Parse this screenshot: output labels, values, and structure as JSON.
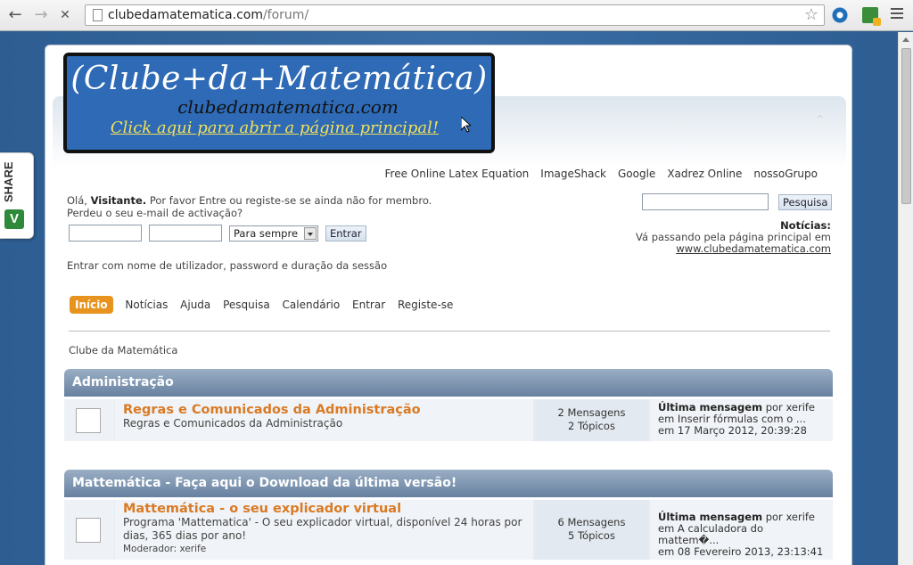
{
  "browser": {
    "url_host": "clubedamatematica.com",
    "url_path": "/forum/"
  },
  "logo": {
    "title": "(Clube+da+Matemática)",
    "subtitle": "clubedamatematica.com",
    "link": "Click aqui para abrir a página principal!"
  },
  "top_links": [
    "Free Online Latex Equation",
    "ImageShack",
    "Google",
    "Xadrez Online",
    "nossoGrupo"
  ],
  "login": {
    "greeting_prefix": "Olá,",
    "greeting_user": "Visitante.",
    "greeting_suffix": "Por favor Entre ou registe-se se ainda não for membro.",
    "lost_email": "Perdeu o seu e-mail de activação?",
    "duration_value": "Para sempre",
    "enter_button": "Entrar",
    "hint": "Entrar com nome de utilizador, password e duração da sessão"
  },
  "search": {
    "button": "Pesquisa"
  },
  "news": {
    "label": "Notícias:",
    "text": "Vá passando pela página principal em",
    "link": "www.clubedamatematica.com"
  },
  "menu": [
    "Início",
    "Notícias",
    "Ajuda",
    "Pesquisa",
    "Calendário",
    "Entrar",
    "Registe-se"
  ],
  "breadcrumb": "Clube da Matemática",
  "categories": [
    {
      "title": "Administração",
      "board": {
        "name": "Regras e Comunicados da Administração",
        "description": "Regras e Comunicados da Administração",
        "moderator": "",
        "messages": "2 Mensagens",
        "topics": "2 Tópicos",
        "last_label": "Última mensagem",
        "last_by": "por xerife",
        "last_in": "em Inserir fórmulas com o ...",
        "last_date": "em 17 Março 2012, 20:39:28"
      }
    },
    {
      "title": "Mattemática - Faça aqui o Download da última versão!",
      "board": {
        "name": "Mattemática - o seu explicador virtual",
        "description": "Programa 'Mattematica' - O seu explicador virtual, disponível 24 horas por dias, 365 dias por ano!",
        "moderator": "Moderador: xerife",
        "messages": "6 Mensagens",
        "topics": "5 Tópicos",
        "last_label": "Última mensagem",
        "last_by": "por xerife",
        "last_in": "em A calculadora do mattem�...",
        "last_date": "em 08 Fevereiro 2013, 23:13:41"
      }
    }
  ],
  "share": {
    "label": "SHARE",
    "icon_text": "V"
  }
}
